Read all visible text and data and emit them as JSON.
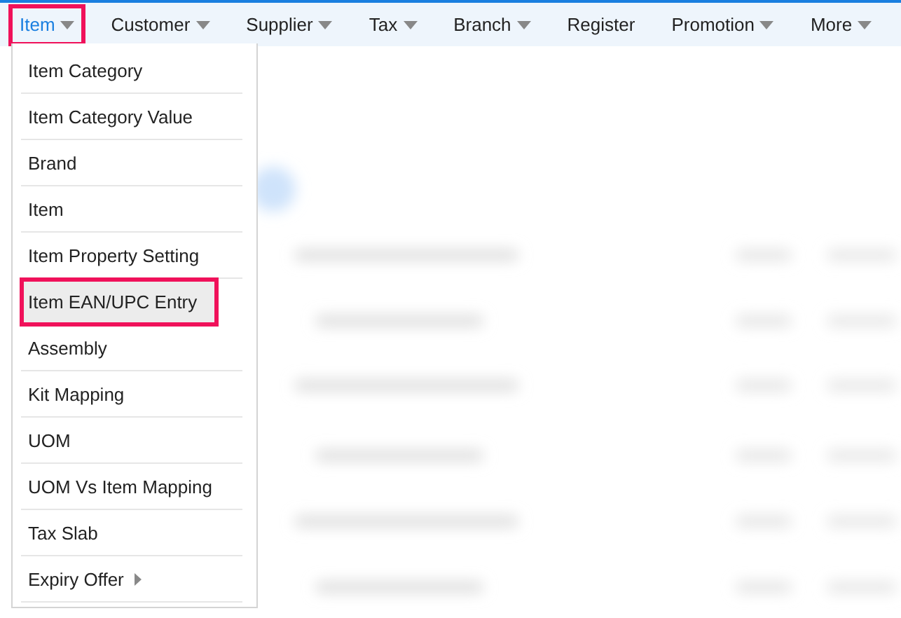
{
  "nav": [
    {
      "label": "Item",
      "selected": true,
      "highlighted": true,
      "caret": true
    },
    {
      "label": "Customer",
      "selected": false,
      "highlighted": false,
      "caret": true
    },
    {
      "label": "Supplier",
      "selected": false,
      "highlighted": false,
      "caret": true
    },
    {
      "label": "Tax",
      "selected": false,
      "highlighted": false,
      "caret": true
    },
    {
      "label": "Branch",
      "selected": false,
      "highlighted": false,
      "caret": true
    },
    {
      "label": "Register",
      "selected": false,
      "highlighted": false,
      "caret": false
    },
    {
      "label": "Promotion",
      "selected": false,
      "highlighted": false,
      "caret": true
    },
    {
      "label": "More",
      "selected": false,
      "highlighted": false,
      "caret": true
    }
  ],
  "dropdown": [
    {
      "label": "Item Category",
      "highlighted": false,
      "submenu": false
    },
    {
      "label": "Item Category Value",
      "highlighted": false,
      "submenu": false
    },
    {
      "label": "Brand",
      "highlighted": false,
      "submenu": false
    },
    {
      "label": "Item",
      "highlighted": false,
      "submenu": false
    },
    {
      "label": "Item Property Setting",
      "highlighted": false,
      "submenu": false
    },
    {
      "label": "Item EAN/UPC Entry",
      "highlighted": true,
      "submenu": false
    },
    {
      "label": "Assembly",
      "highlighted": false,
      "submenu": false
    },
    {
      "label": "Kit Mapping",
      "highlighted": false,
      "submenu": false
    },
    {
      "label": "UOM",
      "highlighted": false,
      "submenu": false
    },
    {
      "label": "UOM Vs Item Mapping",
      "highlighted": false,
      "submenu": false
    },
    {
      "label": "Tax Slab",
      "highlighted": false,
      "submenu": false
    },
    {
      "label": "Expiry Offer",
      "highlighted": false,
      "submenu": true
    }
  ]
}
